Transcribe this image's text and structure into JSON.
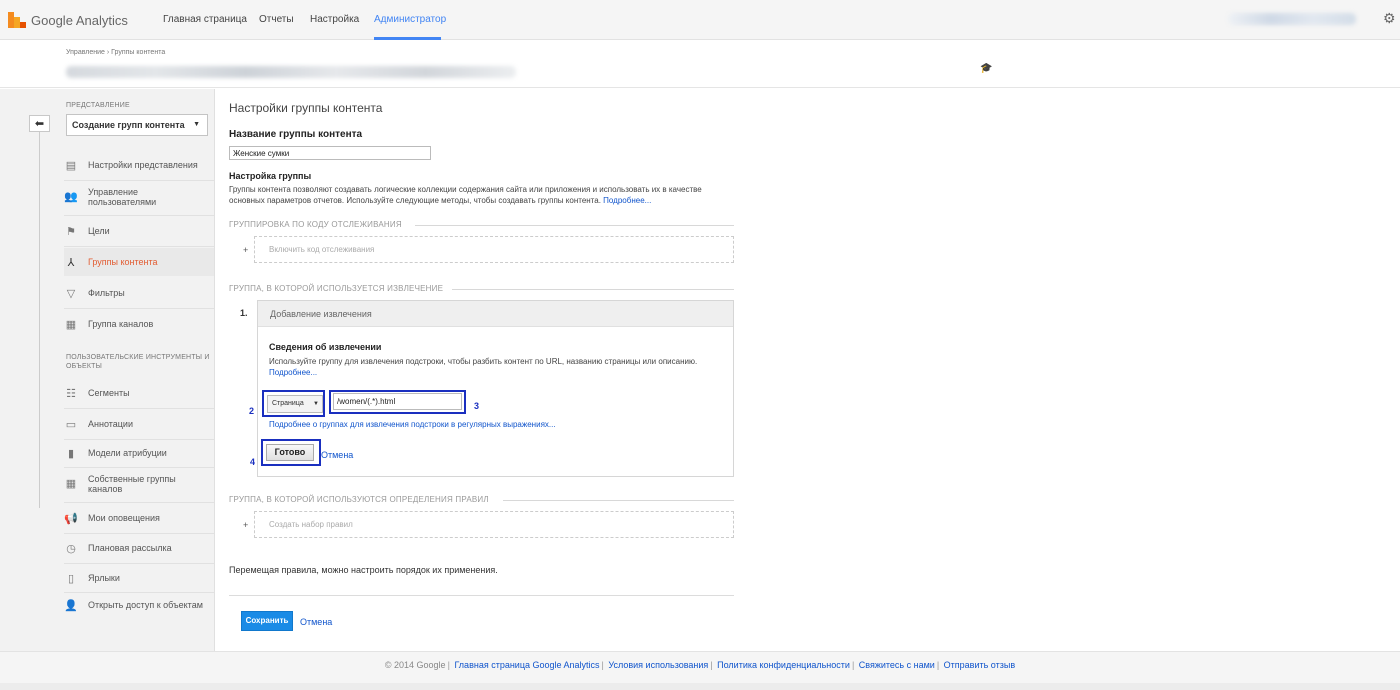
{
  "header": {
    "logo_text": "Google Analytics",
    "nav": [
      "Главная страница",
      "Отчеты",
      "Настройка",
      "Администратор"
    ],
    "active_nav": "Администратор"
  },
  "subheader": {
    "breadcrumb": "Управление › Группы контента"
  },
  "sidebar": {
    "section_view": "ПРЕДСТАВЛЕНИЕ",
    "view_select": "Создание групп контента",
    "items": [
      {
        "label": "Настройки представления",
        "icon": "document-icon"
      },
      {
        "label": "Управление пользователями",
        "icon": "users-icon"
      },
      {
        "label": "Цели",
        "icon": "flag-icon"
      },
      {
        "label": "Группы контента",
        "icon": "content-group-icon",
        "active": true
      },
      {
        "label": "Фильтры",
        "icon": "filter-icon"
      },
      {
        "label": "Группа каналов",
        "icon": "channel-group-icon"
      }
    ],
    "section_tools": "ПОЛЬЗОВАТЕЛЬСКИЕ ИНСТРУМЕНТЫ И ОБЪЕКТЫ",
    "tool_items": [
      {
        "label": "Сегменты",
        "icon": "segments-icon"
      },
      {
        "label": "Аннотации",
        "icon": "annotation-icon"
      },
      {
        "label": "Модели атрибуции",
        "icon": "bar-chart-icon"
      },
      {
        "label": "Собственные группы каналов",
        "icon": "custom-channel-icon"
      },
      {
        "label": "Мои оповещения",
        "icon": "megaphone-icon"
      },
      {
        "label": "Плановая рассылка",
        "icon": "clock-icon"
      },
      {
        "label": "Ярлыки",
        "icon": "shortcut-icon"
      },
      {
        "label": "Открыть доступ к объектам",
        "icon": "share-user-icon"
      }
    ]
  },
  "main": {
    "title": "Настройки группы контента",
    "name_label": "Название группы контента",
    "name_value": "Женские сумки",
    "setup_label": "Настройка группы",
    "setup_desc_1": "Группы контента позволяют создавать логические коллекции содержания сайта или приложения и использовать их в качестве",
    "setup_desc_2": "основных параметров отчетов. Используйте следующие методы, чтобы создавать группы контента. ",
    "more_link": "Подробнее...",
    "sec_tracking": "ГРУППИРОВКА ПО КОДУ ОТСЛЕЖИВАНИЯ",
    "enable_tracking": "Включить код отслеживания",
    "sec_extraction": "ГРУППА, В КОТОРОЙ ИСПОЛЬЗУЕТСЯ ИЗВЛЕЧЕНИЕ",
    "extract_number": "1.",
    "extract_header": "Добавление извлечения",
    "extract_title": "Сведения об извлечении",
    "extract_desc": "Используйте группу для извлечения подстроки, чтобы разбить контент по URL, названию страницы или описанию.",
    "extract_more": "Подробнее...",
    "dimension_select": "Страница",
    "regex_value": "/women/(.*).html",
    "regex_link": "Подробнее о группах для извлечения подстроки в регулярных выражениях...",
    "done": "Готово",
    "cancel": "Отмена",
    "annot_2": "2",
    "annot_3": "3",
    "annot_4": "4",
    "sec_rules": "ГРУППА, В КОТОРОЙ ИСПОЛЬЗУЮТСЯ ОПРЕДЕЛЕНИЯ ПРАВИЛ",
    "create_rules": "Создать набор правил",
    "plus": "+",
    "order_text": "Перемещая правила, можно настроить порядок их применения.",
    "save": "Сохранить",
    "cancel_bottom": "Отмена"
  },
  "footer": {
    "copyright": "© 2014 Google",
    "links": [
      "Главная страница Google Analytics",
      "Условия использования",
      "Политика конфиденциальности",
      "Свяжитесь с нами",
      "Отправить отзыв"
    ]
  },
  "colors": {
    "accent": "#4285f4",
    "active_sidebar": "#e25d33",
    "annotation": "#1a2fbf",
    "save_button": "#1a8be6",
    "link": "#1155cc"
  }
}
